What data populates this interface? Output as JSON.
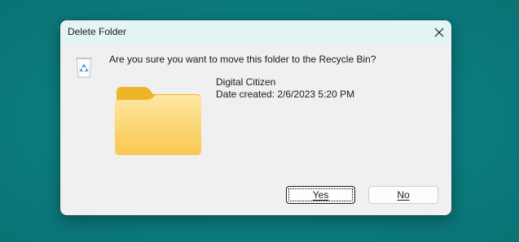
{
  "dialog": {
    "title": "Delete Folder",
    "question": "Are you sure you want to move this folder to the Recycle Bin?",
    "item_name": "Digital Citizen",
    "date_created": "Date created: 2/6/2023 5:20 PM",
    "yes_label": "Yes",
    "no_label": "No",
    "icons": {
      "close": "close-icon",
      "recycle": "recycle-bin-icon",
      "folder": "folder-icon"
    }
  },
  "colors": {
    "desktop": "#0b7c7f",
    "titlebar": "#e4f3f3",
    "dialog_bg": "#f0f0f0",
    "folder_front": "#fbd57a",
    "folder_back": "#f0b429"
  }
}
